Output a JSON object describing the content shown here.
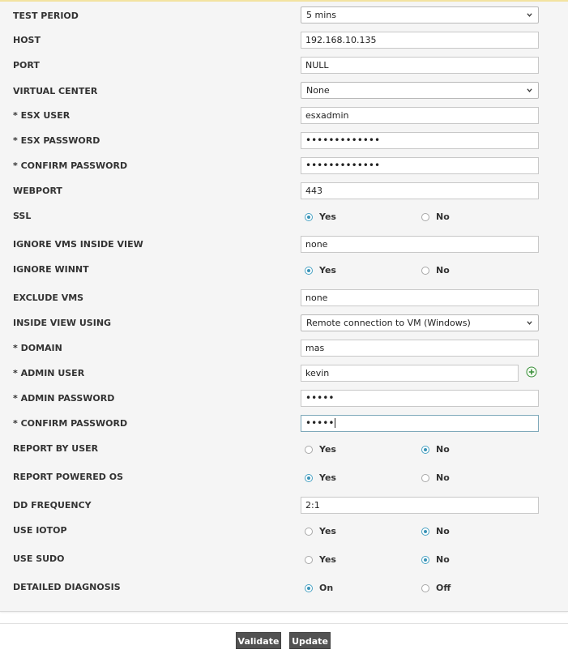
{
  "form": {
    "test_period": {
      "label": "TEST PERIOD",
      "value": "5 mins"
    },
    "host": {
      "label": "HOST",
      "value": "192.168.10.135"
    },
    "port": {
      "label": "PORT",
      "value": "NULL"
    },
    "virtual_center": {
      "label": "VIRTUAL CENTER",
      "value": "None"
    },
    "esx_user": {
      "label": "ESX USER",
      "value": "esxadmin"
    },
    "esx_password": {
      "label": "ESX PASSWORD",
      "value": "•••••••••••••"
    },
    "confirm_password_1": {
      "label": "CONFIRM PASSWORD",
      "value": "•••••••••••••"
    },
    "webport": {
      "label": "WEBPORT",
      "value": "443"
    },
    "ssl": {
      "label": "SSL",
      "options": [
        "Yes",
        "No"
      ],
      "selected": "Yes"
    },
    "ignore_vms_inside_view": {
      "label": "IGNORE VMS INSIDE VIEW",
      "value": "none"
    },
    "ignore_winnt": {
      "label": "IGNORE WINNT",
      "options": [
        "Yes",
        "No"
      ],
      "selected": "Yes"
    },
    "exclude_vms": {
      "label": "EXCLUDE VMS",
      "value": "none"
    },
    "inside_view_using": {
      "label": "INSIDE VIEW USING",
      "value": "Remote connection to VM (Windows)"
    },
    "domain": {
      "label": "DOMAIN",
      "value": "mas"
    },
    "admin_user": {
      "label": "ADMIN USER",
      "value": "kevin"
    },
    "admin_password": {
      "label": "ADMIN PASSWORD",
      "value": "•••••"
    },
    "confirm_password_2": {
      "label": "CONFIRM PASSWORD",
      "value": "•••••"
    },
    "report_by_user": {
      "label": "REPORT BY USER",
      "options": [
        "Yes",
        "No"
      ],
      "selected": "No"
    },
    "report_powered_os": {
      "label": "REPORT POWERED OS",
      "options": [
        "Yes",
        "No"
      ],
      "selected": "Yes"
    },
    "dd_frequency": {
      "label": "DD FREQUENCY",
      "value": "2:1"
    },
    "use_iotop": {
      "label": "USE IOTOP",
      "options": [
        "Yes",
        "No"
      ],
      "selected": "No"
    },
    "use_sudo": {
      "label": "USE SUDO",
      "options": [
        "Yes",
        "No"
      ],
      "selected": "No"
    },
    "detailed_diagnosis": {
      "label": "DETAILED DIAGNOSIS",
      "options": [
        "On",
        "Off"
      ],
      "selected": "On"
    },
    "required_marker": "*"
  },
  "buttons": {
    "validate": "Validate",
    "update": "Update"
  },
  "icons": {
    "chevron": "chevron-down-icon",
    "add": "add-circle-icon"
  },
  "colors": {
    "radio_selected": "#3a93b6",
    "button_bg": "#525252",
    "panel_bg": "#f5f5f5",
    "add_icon": "#3a8f3a"
  }
}
